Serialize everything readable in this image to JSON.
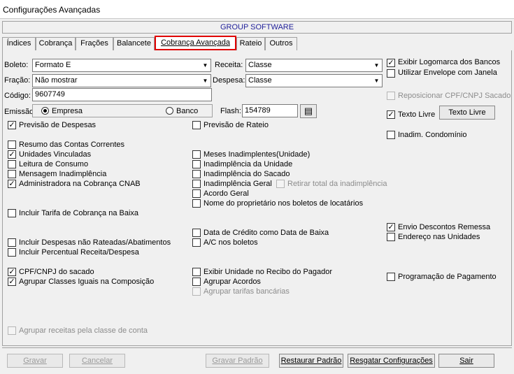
{
  "window": {
    "title": "Configurações Avançadas"
  },
  "banner": "GROUP SOFTWARE",
  "tabs": [
    "Índices",
    "Cobrança",
    "Frações",
    "Balancete",
    "Cobrança Avançada",
    "Rateio",
    "Outros"
  ],
  "active_tab": "Cobrança Avançada",
  "form": {
    "boleto_label": "Boleto:",
    "boleto_value": "Formato E",
    "fracao_label": "Fração:",
    "fracao_value": "Não mostrar",
    "codigo_label": "Código:",
    "codigo_value": "9607749",
    "emissao_label": "Emissão:",
    "emissao_opt1": "Empresa",
    "emissao_opt2": "Banco",
    "receita_label": "Receita:",
    "receita_value": "Classe",
    "despesa_label": "Despesa:",
    "despesa_value": "Classe",
    "flash_label": "Flash:",
    "flash_value": "154789",
    "texto_livre_button": "Texto Livre"
  },
  "checks": {
    "exibir_logomarca": "Exibir Logomarca dos Bancos",
    "utilizar_envelope": "Utilizar Envelope com Janela",
    "reposicionar_cpf": "Reposicionar CPF/CNPJ Sacado",
    "texto_livre": "Texto Livre",
    "inadim_condominio": "Inadim. Condomínio",
    "previsao_despesas": "Previsão de Despesas",
    "previsao_rateio": "Previsão de Rateio",
    "resumo_contas": "Resumo das Contas Correntes",
    "unidades_vinculadas": "Unidades Vinculadas",
    "leitura_consumo": "Leitura de Consumo",
    "mensagem_inadimplencia": "Mensagem Inadimplência",
    "administradora_cnab": "Administradora na Cobrança CNAB",
    "meses_inadimplentes": "Meses Inadimplentes(Unidade)",
    "inadimplencia_unidade": "Inadimplência da Unidade",
    "inadimplencia_sacado": "Inadimplência do Sacado",
    "inadimplencia_geral": "Inadimplência Geral",
    "retirar_total": "Retirar total da inadimplência",
    "acordo_geral": "Acordo Geral",
    "nome_proprietario": "Nome do proprietário nos boletos de locatários",
    "incluir_tarifa": "Incluir Tarifa de Cobrança na Baixa",
    "data_credito": "Data de Crédito como Data de Baixa",
    "ac_boletos": "A/C nos boletos",
    "envio_descontos": "Envio Descontos Remessa",
    "endereco_unidades": "Endereço nas Unidades",
    "incluir_despesas": "Incluir Despesas não Rateadas/Abatimentos",
    "incluir_percentual": "Incluir Percentual Receita/Despesa",
    "cpf_cnpj_sacado": "CPF/CNPJ do sacado",
    "agrupar_classes": "Agrupar Classes Iguais na Composição",
    "exibir_unidade": "Exibir Unidade no Recibo do Pagador",
    "agrupar_acordos": "Agrupar Acordos",
    "agrupar_tarifas": "Agrupar tarifas bancárias",
    "programacao_pagamento": "Programação de Pagamento",
    "agrupar_receitas": "Agrupar receitas pela classe de conta"
  },
  "buttons": {
    "gravar": "Gravar",
    "cancelar": "Cancelar",
    "gravar_padrao": "Gravar Padrão",
    "restaurar_padrao": "Restaurar Padrão",
    "resgatar": "Resgatar Configurações",
    "sair": "Sair"
  },
  "colors": {
    "highlight_border": "#e00000",
    "banner_text": "#1f1f99"
  }
}
